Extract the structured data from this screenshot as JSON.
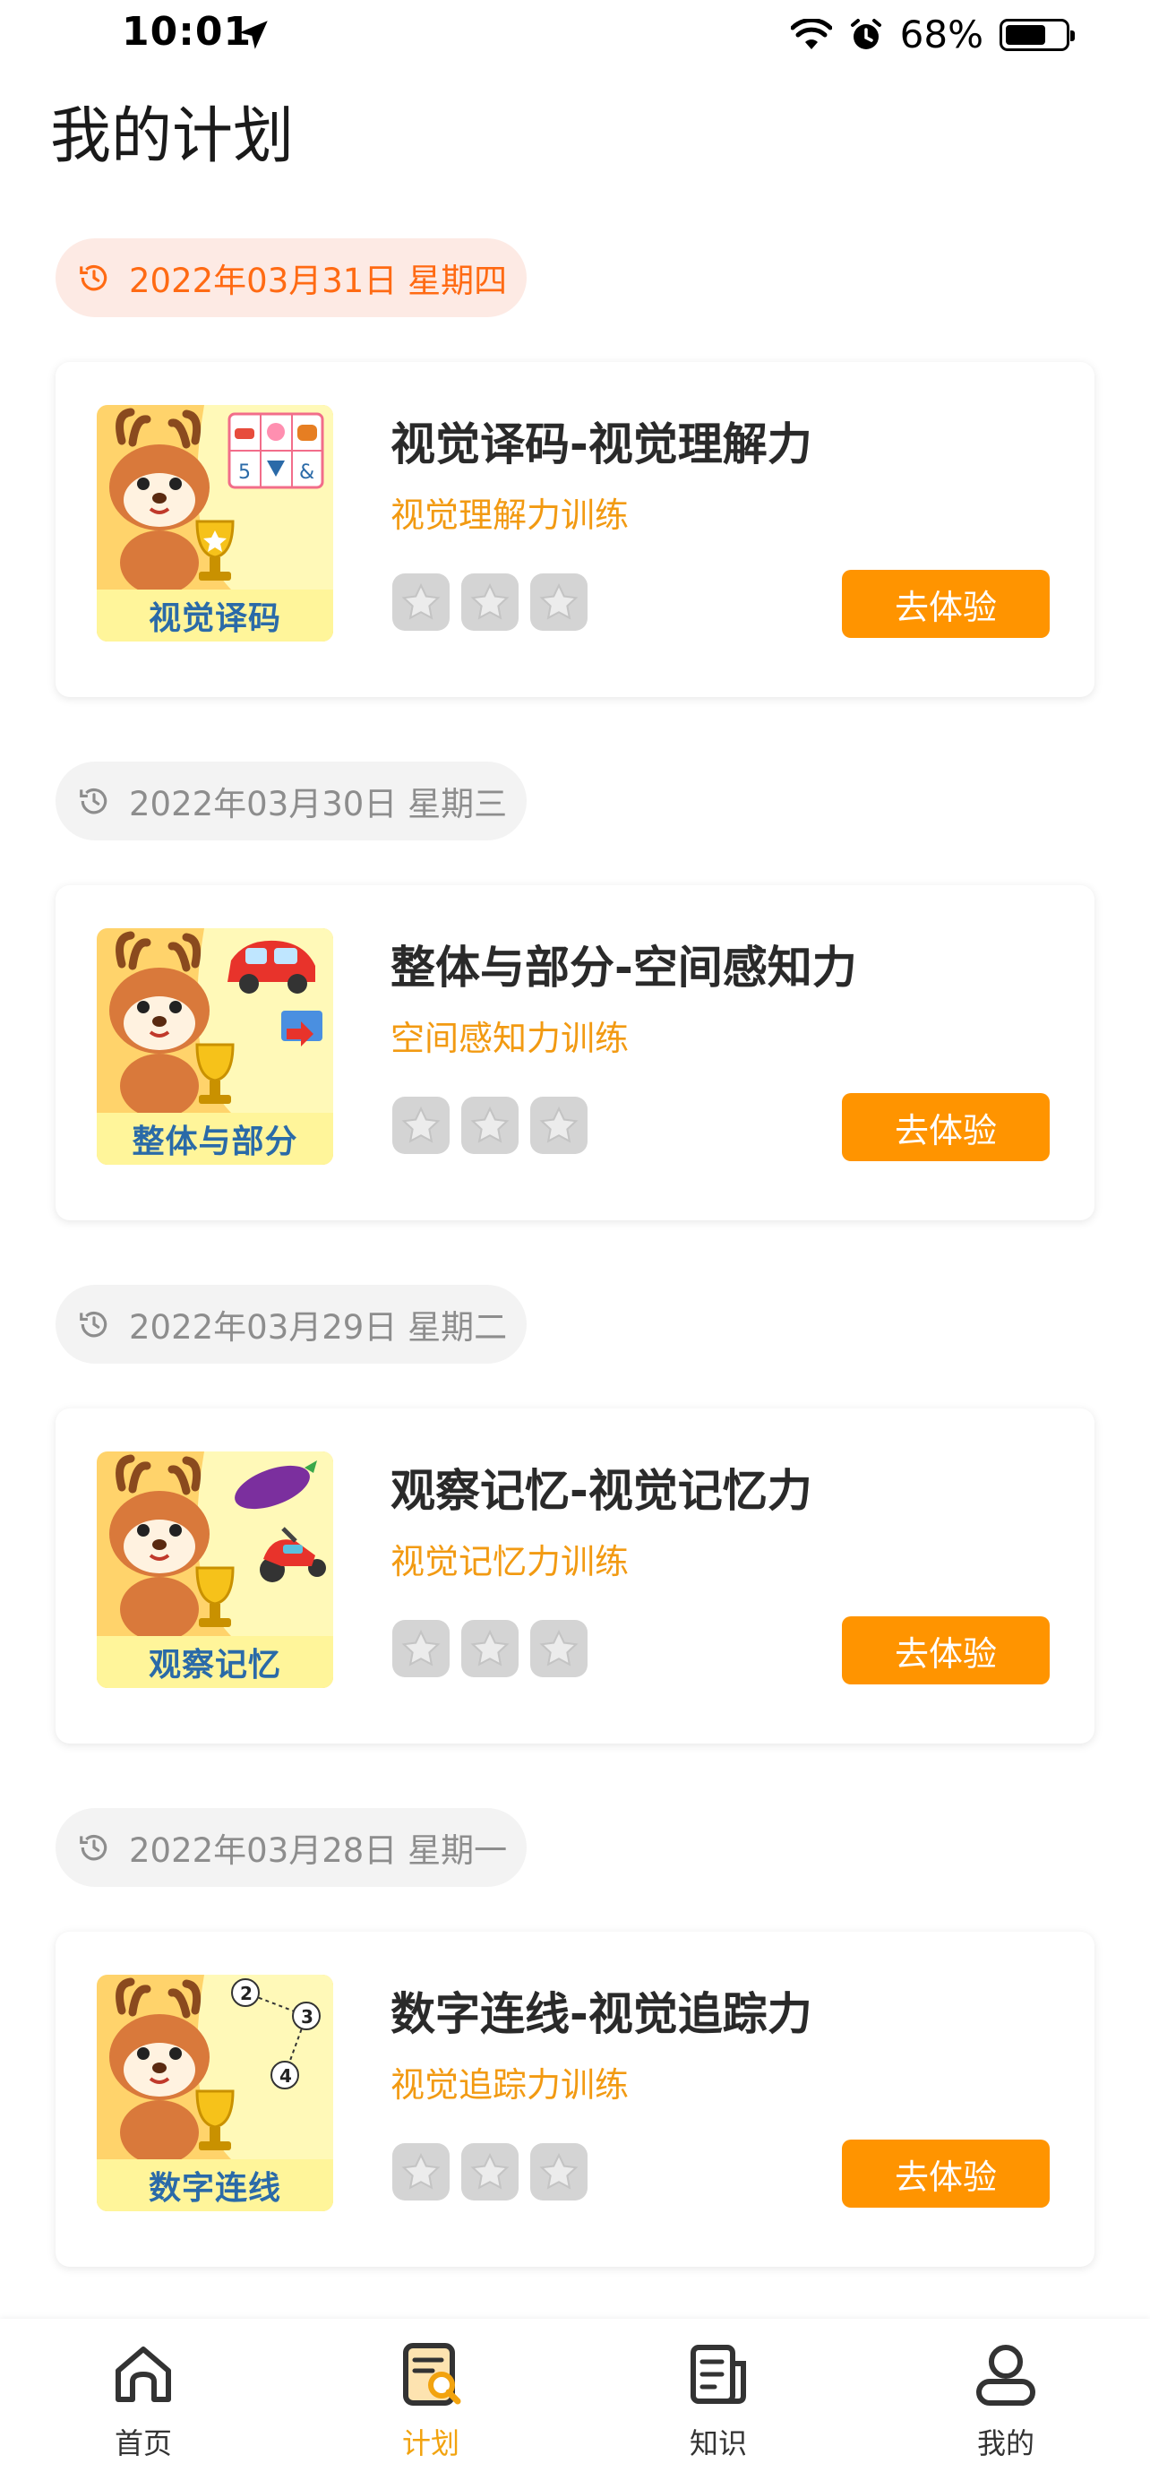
{
  "status_bar": {
    "time": "10:01",
    "battery_percent": "68%",
    "battery_level": 0.68
  },
  "page": {
    "title": "我的计划"
  },
  "plans": [
    {
      "date": "2022年03月31日 星期四",
      "active": true,
      "title": "视觉译码-视觉理解力",
      "subtitle": "视觉理解力训练",
      "thumb_label": "视觉译码",
      "stars_earned": 0,
      "stars_total": 3,
      "button": "去体验"
    },
    {
      "date": "2022年03月30日 星期三",
      "active": false,
      "title": "整体与部分-空间感知力",
      "subtitle": "空间感知力训练",
      "thumb_label": "整体与部分",
      "stars_earned": 0,
      "stars_total": 3,
      "button": "去体验"
    },
    {
      "date": "2022年03月29日 星期二",
      "active": false,
      "title": "观察记忆-视觉记忆力",
      "subtitle": "视觉记忆力训练",
      "thumb_label": "观察记忆",
      "stars_earned": 0,
      "stars_total": 3,
      "button": "去体验"
    },
    {
      "date": "2022年03月28日 星期一",
      "active": false,
      "title": "数字连线-视觉追踪力",
      "subtitle": "视觉追踪力训练",
      "thumb_label": "数字连线",
      "stars_earned": 0,
      "stars_total": 3,
      "button": "去体验"
    }
  ],
  "tab_bar": {
    "items": [
      {
        "label": "首页",
        "icon": "home-icon",
        "active": false
      },
      {
        "label": "计划",
        "icon": "plan-icon",
        "active": true
      },
      {
        "label": "知识",
        "icon": "knowledge-icon",
        "active": false
      },
      {
        "label": "我的",
        "icon": "profile-icon",
        "active": false
      }
    ]
  },
  "colors": {
    "accent": "#ff9400",
    "subtitle": "#f29a12",
    "date_active_bg": "#fdeae4",
    "date_active_text": "#ff6a13",
    "date_past_bg": "#f3f3f3",
    "tab_active": "#f2a30f"
  }
}
